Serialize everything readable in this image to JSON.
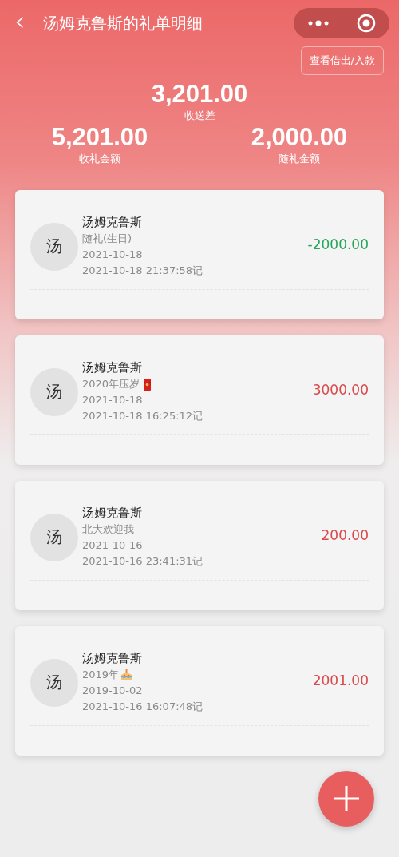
{
  "nav": {
    "back": "‹",
    "title": "汤姆克鲁斯的礼单明细"
  },
  "summary": {
    "link": "查看借出/入款",
    "difference": "3,201.00",
    "difference_label": "收送差",
    "received": "5,201.00",
    "received_label": "收礼金额",
    "given": "2,000.00",
    "given_label": "随礼金额"
  },
  "records": [
    {
      "avatar": "汤",
      "name": "汤姆克鲁斯",
      "event": "随礼(生日)",
      "date": "2021-10-18",
      "recorded": "2021-10-18 21:37:58记",
      "amount": "-2000.00",
      "kind": "given"
    },
    {
      "avatar": "汤",
      "name": "汤姆克鲁斯",
      "event": "2020年压岁",
      "emblem": {
        "kind": "envelope"
      },
      "date": "2021-10-18",
      "recorded": "2021-10-18 16:25:12记",
      "amount": "3000.00",
      "kind": "received"
    },
    {
      "avatar": "汤",
      "name": "汤姆克鲁斯",
      "event": "北大欢迎我",
      "date": "2021-10-16",
      "recorded": "2021-10-16 23:41:31记",
      "amount": "200.00",
      "kind": "received"
    },
    {
      "avatar": "汤",
      "name": "汤姆克鲁斯",
      "event": "2019年",
      "emblem": {
        "kind": "cake"
      },
      "date": "2019-10-02",
      "recorded": "2021-10-16 16:07:48记",
      "amount": "2001.00",
      "kind": "received"
    }
  ]
}
